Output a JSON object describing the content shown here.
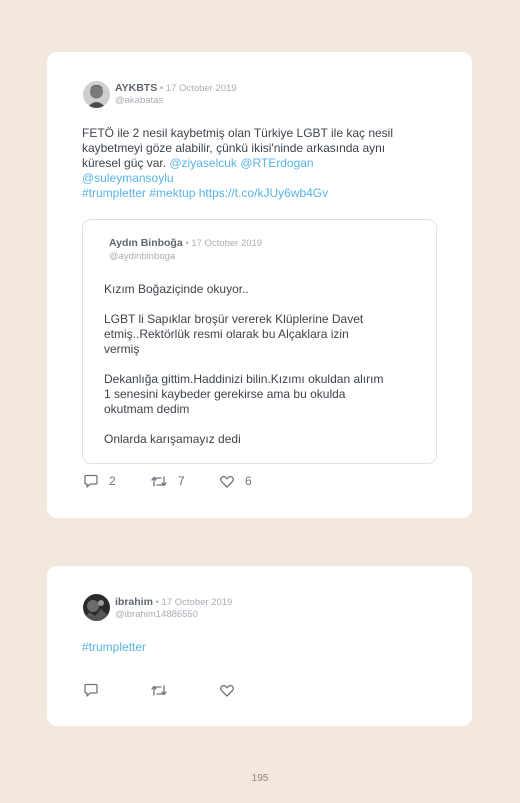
{
  "tweet1": {
    "author_name": "AYKBTS",
    "separator": " • ",
    "date": "17 October 2019",
    "handle": "@akabatas",
    "text_line1": "FETÖ ile 2 nesil kaybetmiş olan Türkiye LGBT ile kaç nesil",
    "text_line2": "kaybetmeyi göze alabilir, çünkü ikisi'ninde arkasında aynı",
    "text_line3_plain": "küresel güç var. ",
    "mention1": "@ziyaselcuk",
    "mention2": "@RTErdogan",
    "mention3": "@suleymansoylu",
    "hashtag1": "#trumpletter",
    "hashtag2": "#mektup",
    "link": "https://t.co/kJUy6wb4Gv",
    "quoted": {
      "author_name": "Aydın Binboğa",
      "separator": " • ",
      "date": "17 October 2019",
      "handle": "@aydinbinboga",
      "lines": [
        "Kızım Boğaziçinde okuyor..",
        "LGBT li Sapıklar broşür vererek Klüplerine Davet",
        "etmiş..Rektörlük resmi olarak bu Alçaklara izin",
        "vermiş",
        "Dekanlığa gittim.Haddinizi bilin.Kızımı okuldan alırım",
        "1 senesini kaybeder gerekirse ama bu okulda",
        "okutmam dedim",
        "Onlarda karışamayız dedi"
      ]
    },
    "replies": "2",
    "retweets": "7",
    "likes": "6"
  },
  "tweet2": {
    "author_name": "ibrahim",
    "separator": " • ",
    "date": "17 October 2019",
    "handle": "@ibrahim14886550",
    "hashtag": "#trumpletter"
  },
  "page_number": "195",
  "colors": {
    "background": "#f3e8de",
    "card": "#ffffff",
    "link": "#57b4e8",
    "text": "#3d444b",
    "muted": "#a7aeb5"
  }
}
